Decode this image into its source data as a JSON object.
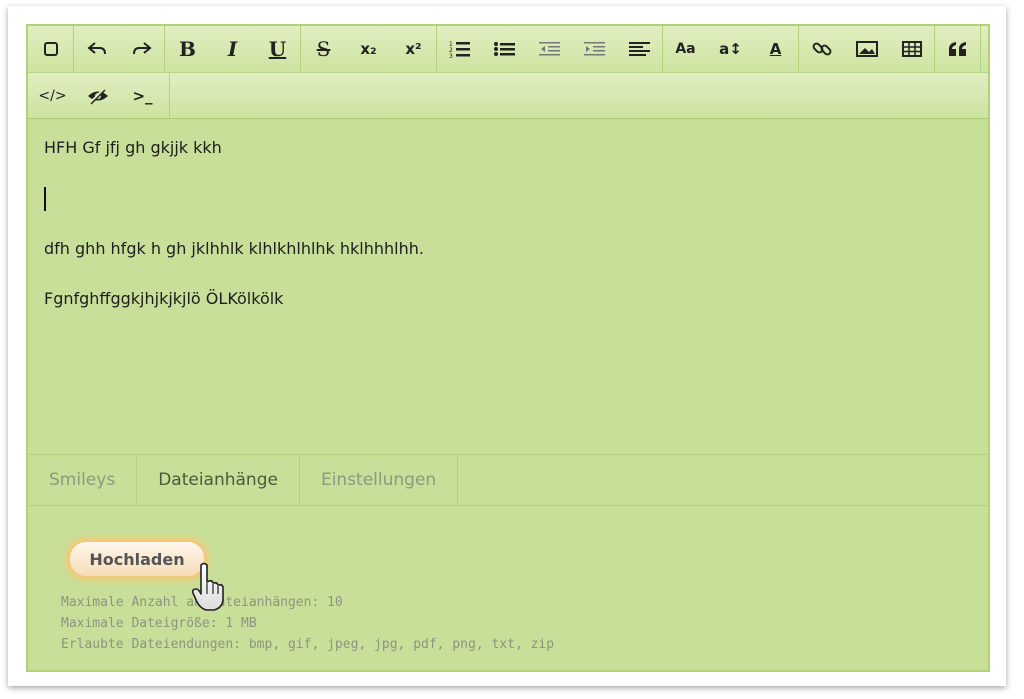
{
  "toolbar": {
    "row1": [
      {
        "name": "remove-format-button",
        "icon": "square-icon"
      },
      {
        "name": "undo-button",
        "icon": "undo-icon"
      },
      {
        "name": "redo-button",
        "icon": "redo-icon"
      },
      {
        "name": "bold-button",
        "icon": "bold-icon",
        "label": "B"
      },
      {
        "name": "italic-button",
        "icon": "italic-icon",
        "label": "I"
      },
      {
        "name": "underline-button",
        "icon": "underline-icon",
        "label": "U"
      },
      {
        "name": "strikethrough-button",
        "icon": "strikethrough-icon",
        "label": "S"
      },
      {
        "name": "subscript-button",
        "icon": "subscript-icon",
        "label": "x₂"
      },
      {
        "name": "superscript-button",
        "icon": "superscript-icon",
        "label": "x²"
      },
      {
        "name": "ordered-list-button",
        "icon": "ordered-list-icon"
      },
      {
        "name": "unordered-list-button",
        "icon": "unordered-list-icon"
      },
      {
        "name": "outdent-button",
        "icon": "outdent-icon"
      },
      {
        "name": "indent-button",
        "icon": "indent-icon"
      },
      {
        "name": "align-button",
        "icon": "align-left-icon"
      },
      {
        "name": "font-family-button",
        "icon": "font-family-icon",
        "label": "Aa"
      },
      {
        "name": "font-size-button",
        "icon": "font-size-icon",
        "label": "a↕"
      },
      {
        "name": "font-color-button",
        "icon": "font-color-icon",
        "label": "A"
      },
      {
        "name": "link-button",
        "icon": "link-icon"
      },
      {
        "name": "image-button",
        "icon": "image-icon"
      },
      {
        "name": "table-button",
        "icon": "table-icon"
      },
      {
        "name": "quote-button",
        "icon": "quote-icon"
      }
    ],
    "row2": [
      {
        "name": "source-code-button",
        "icon": "code-icon",
        "label": "</>"
      },
      {
        "name": "spoiler-button",
        "icon": "eye-slash-icon"
      },
      {
        "name": "inline-code-button",
        "icon": "terminal-icon",
        "label": ">_"
      }
    ]
  },
  "content": {
    "line1": "HFH Gf jfj gh gkjjk kkh",
    "line2": "",
    "line3": "dfh ghh hfgk h gh jklhhlk klhlkhlhlhk hklhhhlhh.",
    "line4": "Fgnfghffggkjhjkjkjlö ÖLKölkölk"
  },
  "tabs": [
    "Smileys",
    "Dateianhänge",
    "Einstellungen"
  ],
  "active_tab": "Dateianhänge",
  "attachments": {
    "upload_label": "Hochladen",
    "info": [
      "Maximale Anzahl an Dateianhängen: 10",
      "Maximale Dateigröße: 1 MB",
      "Erlaubte Dateiendungen: bmp, gif, jpeg, jpg, pdf, png, txt, zip"
    ]
  },
  "colors": {
    "editor_bg": "#c8df9a",
    "toolbar_bg": "#dcebb8",
    "border": "#b3d37a",
    "button_glow": "#f6dcb8"
  }
}
